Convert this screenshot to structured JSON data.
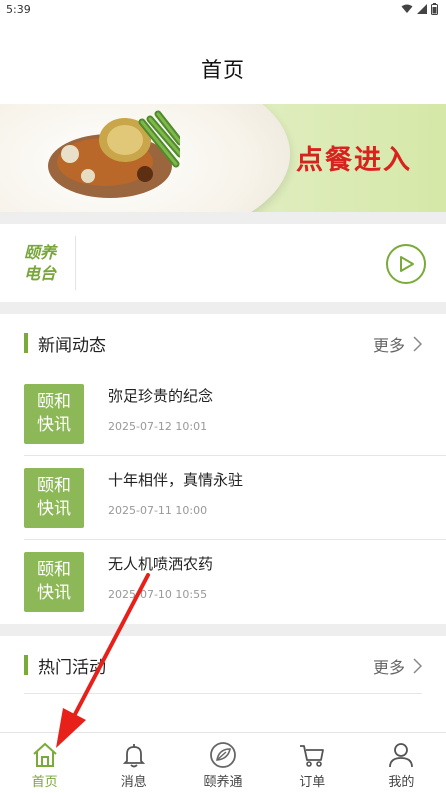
{
  "status_bar": {
    "time": "5:39"
  },
  "header": {
    "title": "首页"
  },
  "banner": {
    "text": "点餐进入"
  },
  "radio": {
    "label_line1": "颐养",
    "label_line2": "电台"
  },
  "news": {
    "title": "新闻动态",
    "more": "更多",
    "items": [
      {
        "badge_line1": "颐和",
        "badge_line2": "快讯",
        "title": "弥足珍贵的纪念",
        "date": "2025-07-12 10:01"
      },
      {
        "badge_line1": "颐和",
        "badge_line2": "快讯",
        "title": "十年相伴，真情永驻",
        "date": "2025-07-11 10:00"
      },
      {
        "badge_line1": "颐和",
        "badge_line2": "快讯",
        "title": "无人机喷洒农药",
        "date": "2025-07-10 10:55"
      }
    ]
  },
  "hot": {
    "title": "热门活动",
    "more": "更多"
  },
  "tabs": [
    {
      "label": "首页",
      "icon": "home-icon",
      "active": true
    },
    {
      "label": "消息",
      "icon": "bell-icon",
      "active": false
    },
    {
      "label": "颐养通",
      "icon": "leaf-icon",
      "active": false
    },
    {
      "label": "订单",
      "icon": "cart-icon",
      "active": false
    },
    {
      "label": "我的",
      "icon": "person-icon",
      "active": false
    }
  ],
  "colors": {
    "accent": "#7aab3a",
    "badge": "#8db858",
    "banner_text": "#d8221d",
    "annotation_arrow": "#e8201a"
  }
}
